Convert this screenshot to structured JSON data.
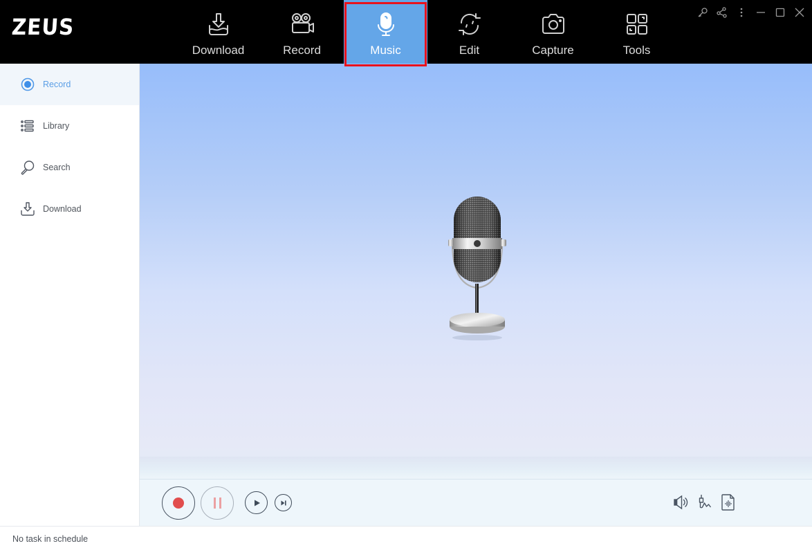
{
  "app": {
    "logo": "ZEUS"
  },
  "nav": {
    "items": [
      {
        "label": "Download",
        "icon": "download-tray-icon"
      },
      {
        "label": "Record",
        "icon": "video-camera-icon"
      },
      {
        "label": "Music",
        "icon": "microphone-icon",
        "active": true
      },
      {
        "label": "Edit",
        "icon": "refresh-cycle-icon"
      },
      {
        "label": "Capture",
        "icon": "camera-icon"
      },
      {
        "label": "Tools",
        "icon": "grid-tools-icon"
      }
    ],
    "active_color": "#64a6e8",
    "highlight_color": "#e8121c"
  },
  "window_controls": [
    "key-icon",
    "share-icon",
    "more-icon",
    "minimize-icon",
    "maximize-icon",
    "close-icon"
  ],
  "sidebar": {
    "items": [
      {
        "label": "Record",
        "icon": "record-radio-icon",
        "active": true
      },
      {
        "label": "Library",
        "icon": "list-icon"
      },
      {
        "label": "Search",
        "icon": "search-icon"
      },
      {
        "label": "Download",
        "icon": "download-icon"
      }
    ],
    "active_color": "#5a9ee6"
  },
  "player": {
    "buttons": [
      "record",
      "pause",
      "play",
      "next"
    ],
    "tools": [
      "volume-icon",
      "audio-source-icon",
      "audio-file-icon"
    ],
    "record_color": "#e14d4d"
  },
  "status": {
    "text": "No task in schedule"
  }
}
